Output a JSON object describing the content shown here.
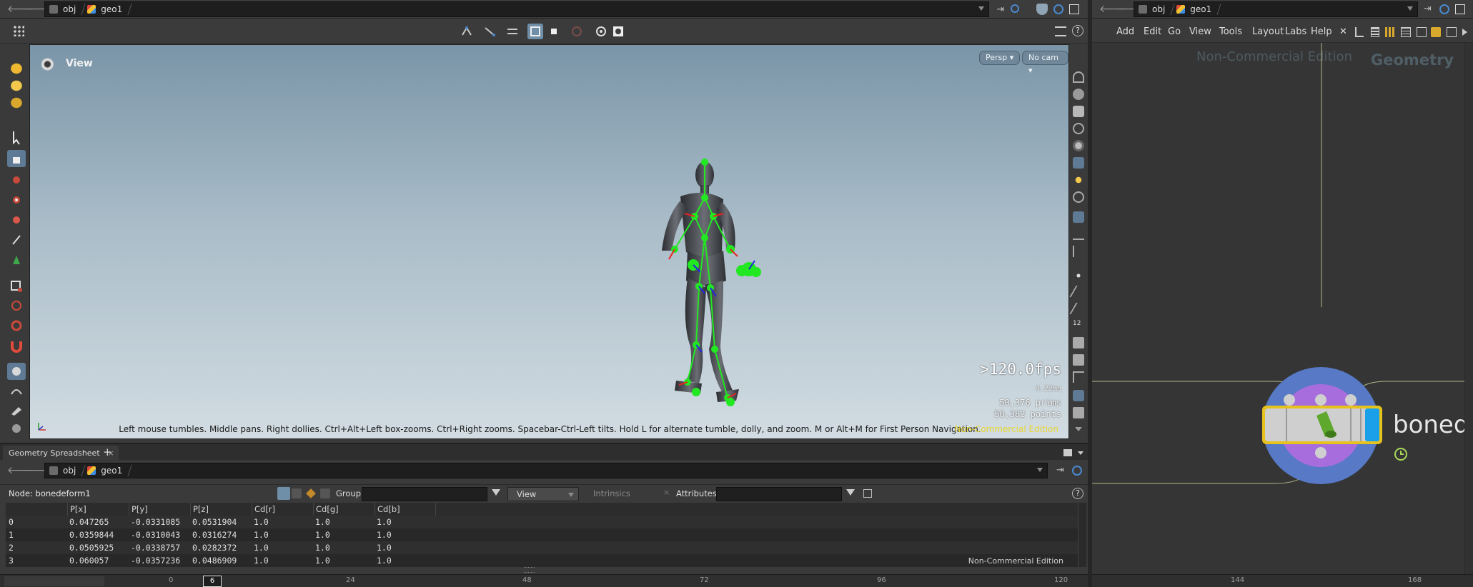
{
  "viewer_pane": {
    "path": {
      "crumb1": "obj",
      "crumb2": "geo1"
    },
    "viewport": {
      "title": "View",
      "persp_menu": "Persp ▾",
      "cam_menu": "No cam ▾",
      "fps": ">120.0fps",
      "time_ms": "4.22ms",
      "prims": "50,376  prims",
      "points": "50,382 points",
      "hint": "Left mouse tumbles. Middle pans. Right dollies. Ctrl+Alt+Left box-zooms. Ctrl+Right zooms. Spacebar-Ctrl-Left tilts. Hold L for alternate tumble, dolly, and zoom. M or Alt+M for First Person Navigation.",
      "watermark": "Non-Commercial Edition"
    }
  },
  "spreadsheet": {
    "tab_label": "Geometry Spreadsheet",
    "tab_close": "×",
    "add_tab": "+",
    "path": {
      "crumb1": "obj",
      "crumb2": "geo1"
    },
    "node_label": "Node: bonedeform1",
    "group_label": "Group:",
    "group_value": "",
    "view_select": "View",
    "intrinsics_label": "Intrinsics",
    "attributes_label": "Attributes:",
    "attributes_value": "",
    "help": "?",
    "columns": [
      "",
      "P[x]",
      "P[y]",
      "P[z]",
      "Cd[r]",
      "Cd[g]",
      "Cd[b]"
    ],
    "rows": [
      [
        "0",
        "0.047265",
        "-0.0331085",
        "0.0531904",
        "1.0",
        "1.0",
        "1.0"
      ],
      [
        "1",
        "0.0359844",
        "-0.0310043",
        "0.0316274",
        "1.0",
        "1.0",
        "1.0"
      ],
      [
        "2",
        "0.0505925",
        "-0.0338757",
        "0.0282372",
        "1.0",
        "1.0",
        "1.0"
      ],
      [
        "3",
        "0.060057",
        "-0.0357236",
        "0.0486909",
        "1.0",
        "1.0",
        "1.0"
      ]
    ],
    "watermark": "Non-Commercial Edition"
  },
  "timeline": {
    "current_frame": "6",
    "ticks": [
      "0",
      "24",
      "48",
      "72",
      "96",
      "120",
      "144",
      "168"
    ]
  },
  "network_pane": {
    "path": {
      "crumb1": "obj",
      "crumb2": "geo1"
    },
    "menu": [
      "Add",
      "Edit",
      "Go",
      "View",
      "Tools",
      "Layout",
      "Labs",
      "Help"
    ],
    "watermark": "Non-Commercial Edition",
    "context_label": "Geometry",
    "node_name": "boned"
  },
  "colors": {
    "accent_blue": "#1aa0e8",
    "selection_yellow": "#e8d62e",
    "skeleton_green": "#22e822"
  }
}
